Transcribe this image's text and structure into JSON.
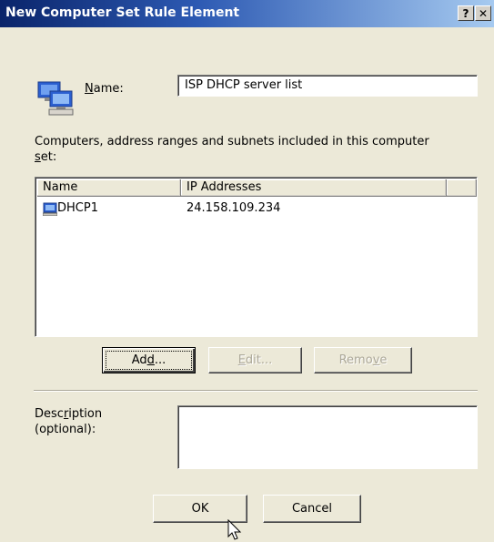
{
  "window": {
    "title": "New Computer Set Rule Element",
    "help_btn": "?",
    "close_btn": "✕"
  },
  "name_label_pre": "",
  "name_label_ul": "N",
  "name_label_post": "ame:",
  "name_value": "ISP DHCP server list",
  "set_desc_line1": "Computers, address ranges and subnets included in this computer",
  "set_desc_ul": "s",
  "set_desc_line2_post": "et:",
  "list": {
    "columns": [
      "Name",
      "IP Addresses"
    ],
    "rows": [
      {
        "name": "DHCP1",
        "ip": "24.158.109.234"
      }
    ]
  },
  "buttons": {
    "add_pre": "Ad",
    "add_ul": "d",
    "add_post": "...",
    "edit_ul": "E",
    "edit_post": "dit...",
    "remove_pre": "Remo",
    "remove_ul": "v",
    "remove_post": "e",
    "ok": "OK",
    "cancel": "Cancel"
  },
  "desc_label_pre": "Desc",
  "desc_label_ul": "r",
  "desc_label_post": "iption",
  "desc_label2": "(optional):",
  "desc_value": ""
}
